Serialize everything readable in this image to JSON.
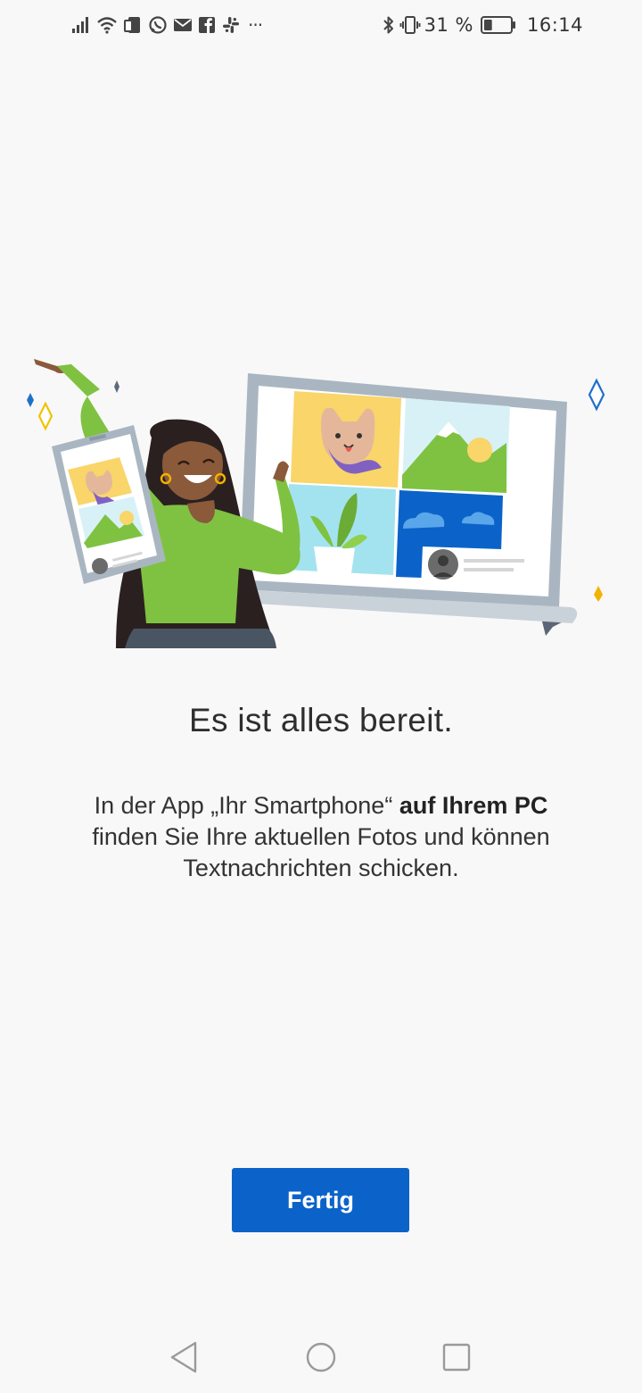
{
  "status_bar": {
    "left_icons": [
      "signal-icon",
      "wifi-icon",
      "sim-icon",
      "whatsapp-icon",
      "mail-icon",
      "facebook-icon",
      "slack-icon",
      "more-icon"
    ],
    "more": "···",
    "battery_percent": "31 %",
    "time": "16:14",
    "right_icons": [
      "bluetooth-icon",
      "vibrate-icon",
      "battery-icon"
    ],
    "battery_level": 0.31
  },
  "main": {
    "headline": "Es ist alles bereit.",
    "body_part1": "In der App „Ihr Smartphone“ ",
    "body_bold": "auf Ihrem PC",
    "body_part2": " finden Sie Ihre aktuellen Fotos und können Textnachrichten schicken.",
    "done_label": "Fertig"
  },
  "colors": {
    "accent": "#0b63c9",
    "background": "#f8f8f8",
    "green_shirt": "#7fc241",
    "skin": "#8a5a3b"
  },
  "nav_bar": {
    "icons": [
      "back-icon",
      "home-icon",
      "recents-icon"
    ]
  }
}
